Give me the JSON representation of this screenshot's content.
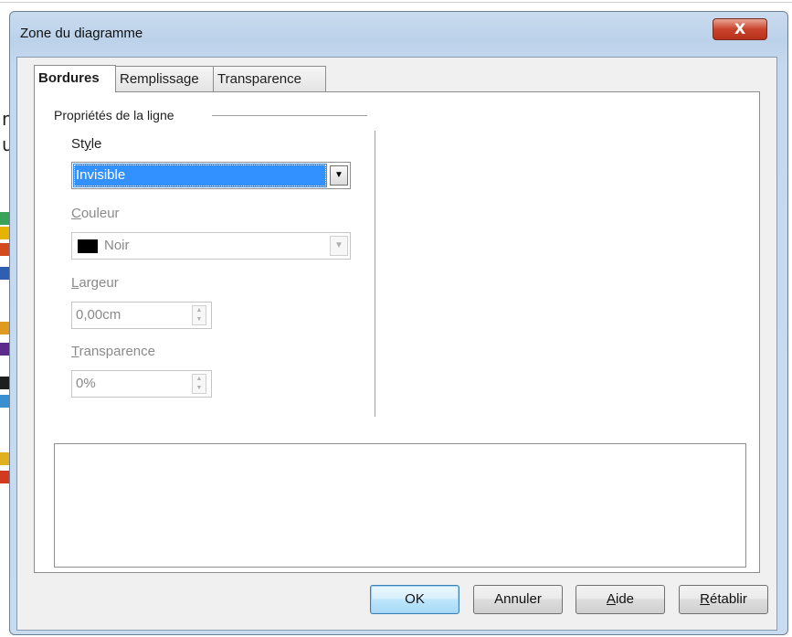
{
  "window": {
    "title": "Zone du diagramme",
    "close_glyph": "X"
  },
  "tabs": [
    {
      "label": "Bordures",
      "active": true
    },
    {
      "label": "Remplissage",
      "active": false
    },
    {
      "label": "Transparence",
      "active": false
    }
  ],
  "line_properties": {
    "group_label": "Propriétés de la ligne",
    "style": {
      "label_pre": "St",
      "label_accel": "y",
      "label_post": "le",
      "value": "Invisible"
    },
    "color": {
      "label_accel": "C",
      "label_post": "ouleur",
      "value": "Noir",
      "swatch_color": "#000000",
      "disabled": true
    },
    "width": {
      "label_accel": "L",
      "label_post": "argeur",
      "value": "0,00cm",
      "disabled": true
    },
    "transparency": {
      "label_accel": "T",
      "label_post": "ransparence",
      "value": "0%",
      "disabled": true
    }
  },
  "buttons": {
    "ok": "OK",
    "cancel": "Annuler",
    "help_accel": "A",
    "help_post": "ide",
    "reset_accel": "R",
    "reset_post": "établir"
  },
  "background": {
    "left_chars": [
      "n",
      "u"
    ]
  },
  "colors": {
    "selection": "#3390ff",
    "close_button": "#c9432c",
    "frame": "#c9dbee"
  }
}
